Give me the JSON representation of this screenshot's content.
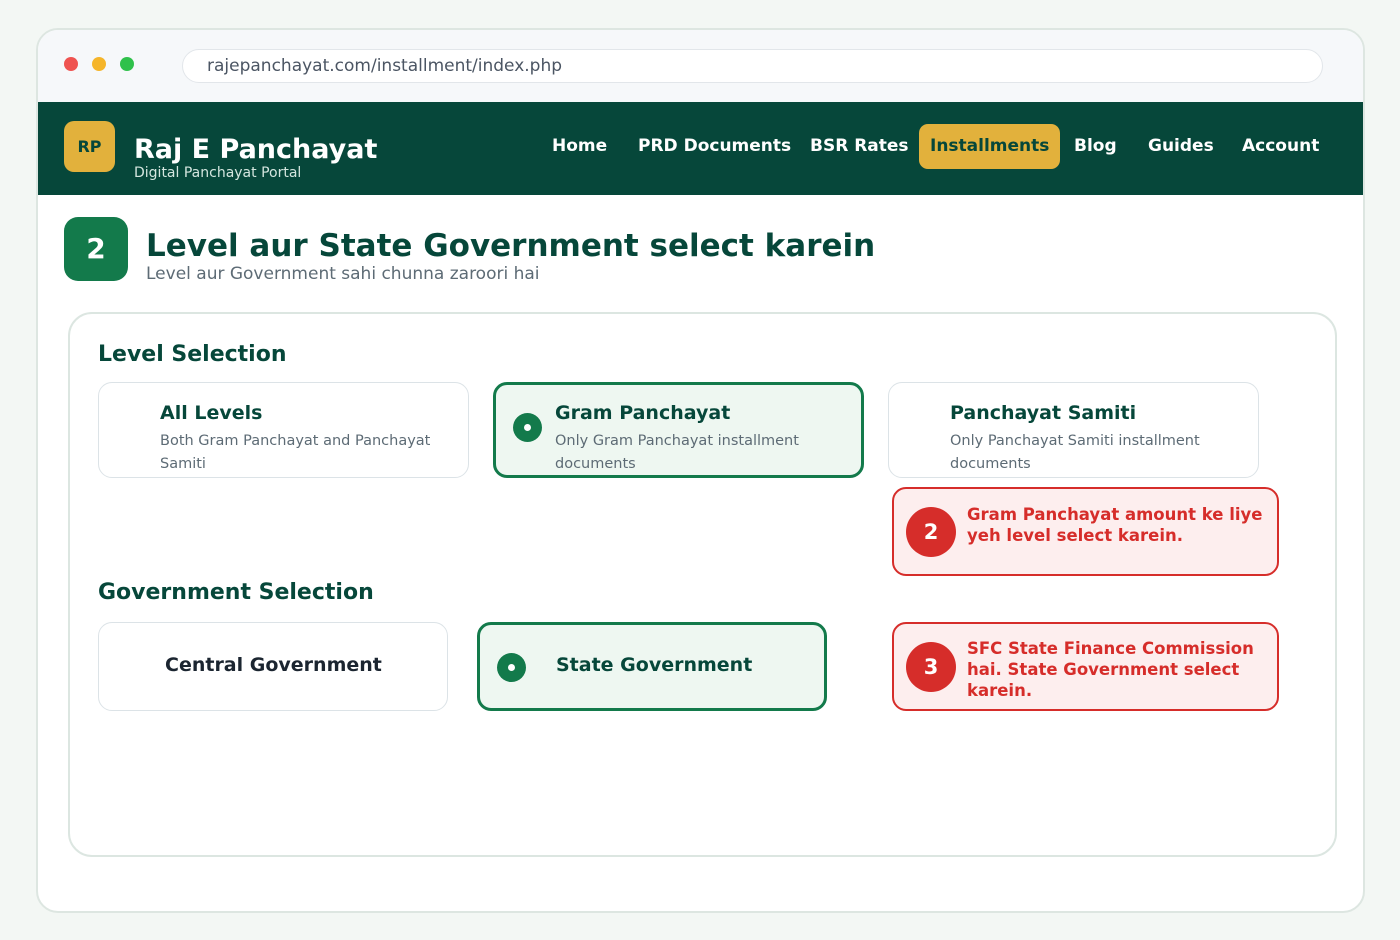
{
  "browser": {
    "url": "rajepanchayat.com/installment/index.php"
  },
  "navbar": {
    "logo_text": "RP",
    "brand_title": "Raj E Panchayat",
    "brand_subtitle": "Digital Panchayat Portal",
    "items": [
      {
        "label": "Home",
        "active": false
      },
      {
        "label": "PRD Documents",
        "active": false
      },
      {
        "label": "BSR Rates",
        "active": false
      },
      {
        "label": "Installments",
        "active": true
      },
      {
        "label": "Blog",
        "active": false
      },
      {
        "label": "Guides",
        "active": false
      },
      {
        "label": "Account",
        "active": false
      }
    ]
  },
  "step": {
    "number": "2",
    "title": "Level aur State Government select karein",
    "subtitle": "Level aur Government sahi chunna zaroori hai"
  },
  "level_selection": {
    "heading": "Level Selection",
    "options": [
      {
        "title": "All Levels",
        "description": "Both Gram Panchayat and Panchayat Samiti",
        "selected": false
      },
      {
        "title": "Gram Panchayat",
        "description": "Only Gram Panchayat installment documents",
        "selected": true
      },
      {
        "title": "Panchayat Samiti",
        "description": "Only Panchayat Samiti installment documents",
        "selected": false
      }
    ]
  },
  "government_selection": {
    "heading": "Government Selection",
    "options": [
      {
        "title": "Central Government",
        "selected": false
      },
      {
        "title": "State Government",
        "selected": true
      }
    ]
  },
  "callouts": [
    {
      "number": "2",
      "text": "Gram Panchayat amount ke liye yeh level select karein."
    },
    {
      "number": "3",
      "text": "SFC State Finance Commission hai. State Government select karein."
    }
  ],
  "colors": {
    "brand_dark": "#06473a",
    "accent_gold": "#e2b13c",
    "selected_green": "#137a4b",
    "callout_red": "#d62d2a"
  }
}
